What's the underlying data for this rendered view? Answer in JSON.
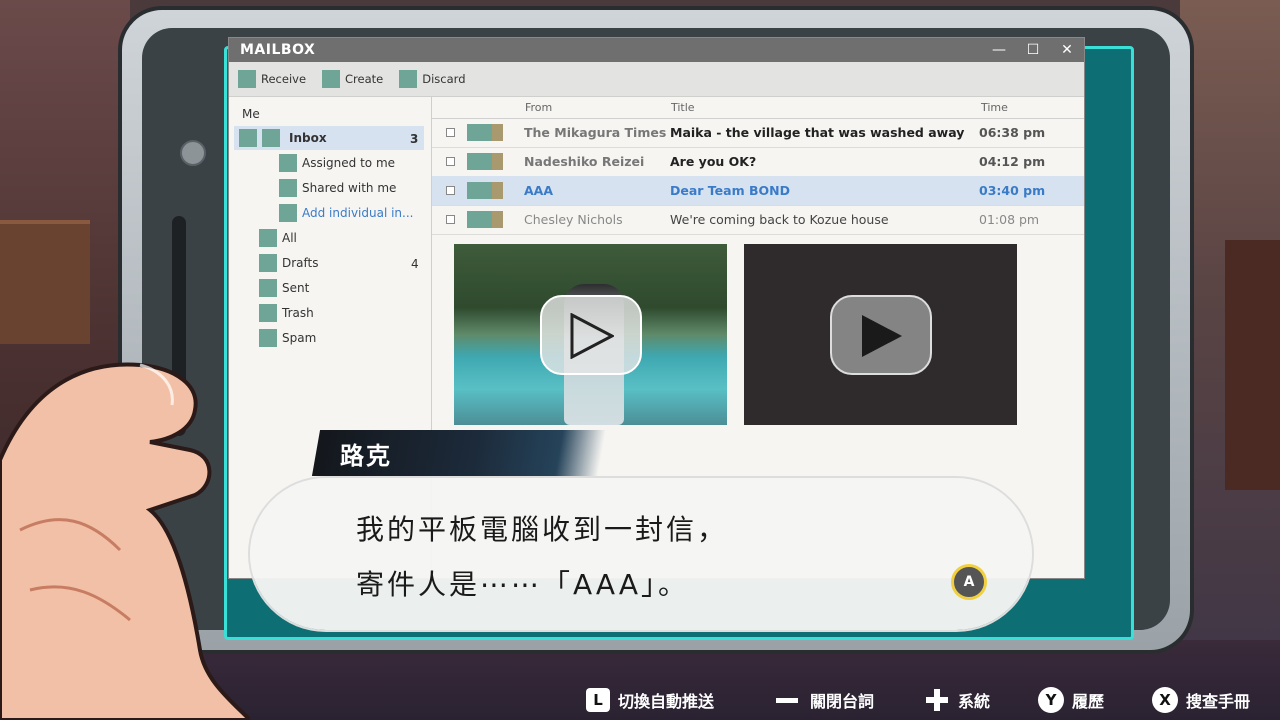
{
  "window": {
    "title": "MAILBOX",
    "controls": {
      "minimize": "—",
      "maximize": "☐",
      "close": "✕"
    }
  },
  "toolbar": {
    "receive": "Receive",
    "create": "Create",
    "discard": "Discard"
  },
  "sidebar": {
    "account": "Me",
    "inbox": {
      "label": "Inbox",
      "count": "3"
    },
    "inbox_children": [
      "Assigned to me",
      "Shared with me",
      "Add individual in..."
    ],
    "folders": [
      {
        "label": "All",
        "count": ""
      },
      {
        "label": "Drafts",
        "count": "4"
      },
      {
        "label": "Sent",
        "count": ""
      },
      {
        "label": "Trash",
        "count": ""
      },
      {
        "label": "Spam",
        "count": ""
      }
    ]
  },
  "maillist": {
    "headers": {
      "from": "From",
      "title": "Title",
      "time": "Time"
    },
    "rows": [
      {
        "from": "The Mikagura Times",
        "title": "Maika - the village that was washed away",
        "time": "06:38 pm"
      },
      {
        "from": "Nadeshiko Reizei",
        "title": "Are you OK?",
        "time": "04:12 pm"
      },
      {
        "from": "AAA",
        "title": "Dear Team BOND",
        "time": "03:40 pm"
      },
      {
        "from": "Chesley Nichols",
        "title": "We're coming back to Kozue house",
        "time": "01:08 pm"
      }
    ]
  },
  "dialogue": {
    "speaker": "路克",
    "line1": "我的平板電腦收到一封信，",
    "line2": "寄件人是⋯⋯「AAA」。",
    "advance_key": "A"
  },
  "controls": [
    {
      "key": "L",
      "label": "切換自動推送"
    },
    {
      "key": "−",
      "label": "關閉台詞"
    },
    {
      "key": "+",
      "label": "系統"
    },
    {
      "key": "Y",
      "label": "履歷"
    },
    {
      "key": "X",
      "label": "搜查手冊"
    }
  ],
  "colors": {
    "accent_teal": "#6fa596",
    "screen_frame": "#0d6f74",
    "selected_row": "#d6e2ef",
    "link_blue": "#3a7bc8"
  }
}
